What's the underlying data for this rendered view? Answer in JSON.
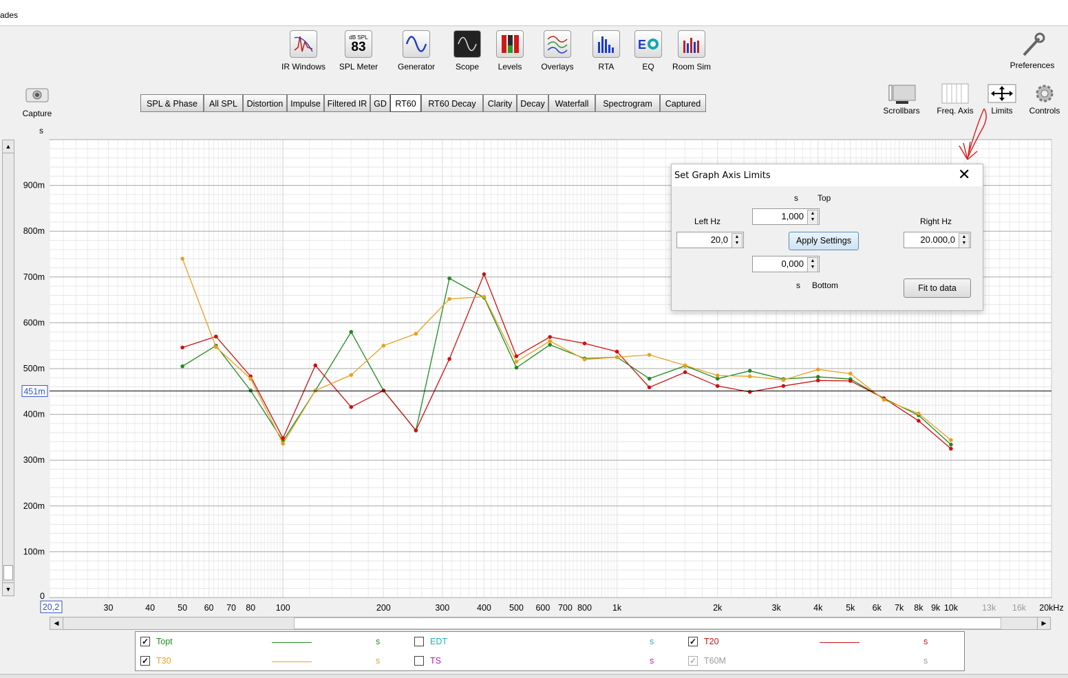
{
  "window": {
    "title_fragment": "ades"
  },
  "toolbar": [
    {
      "label": "IR Windows",
      "icon": "ir-windows-icon"
    },
    {
      "label": "SPL Meter",
      "icon": "spl-meter-icon",
      "meter_top": "dB SPL",
      "meter_value": "83"
    },
    {
      "label": "Generator",
      "icon": "generator-icon"
    },
    {
      "label": "Scope",
      "icon": "scope-icon"
    },
    {
      "label": "Levels",
      "icon": "levels-icon"
    },
    {
      "label": "Overlays",
      "icon": "overlays-icon"
    },
    {
      "label": "RTA",
      "icon": "rta-icon"
    },
    {
      "label": "EQ",
      "icon": "eq-icon"
    },
    {
      "label": "Room Sim",
      "icon": "room-sim-icon"
    }
  ],
  "preferences_label": "Preferences",
  "capture_label": "Capture",
  "tabs": [
    "SPL & Phase",
    "All SPL",
    "Distortion",
    "Impulse",
    "Filtered IR",
    "GD",
    "RT60",
    "RT60 Decay",
    "Clarity",
    "Decay",
    "Waterfall",
    "Spectrogram",
    "Captured"
  ],
  "active_tab": "RT60",
  "right_controls": [
    {
      "label": "Scrollbars",
      "icon": "scrollbars-icon"
    },
    {
      "label": "Freq. Axis",
      "icon": "freq-axis-icon"
    },
    {
      "label": "Limits",
      "icon": "limits-icon"
    },
    {
      "label": "Controls",
      "icon": "controls-gear-icon"
    }
  ],
  "graph": {
    "y_unit": "s",
    "cursor_value": "451m",
    "left_freq_box": "20,2",
    "y_ticks": [
      "900m",
      "800m",
      "700m",
      "600m",
      "500m",
      "400m",
      "300m",
      "200m",
      "100m",
      "0"
    ],
    "x_ticks": [
      "30",
      "40",
      "50",
      "60",
      "70",
      "80",
      "100",
      "200",
      "300",
      "400",
      "500",
      "600",
      "700",
      "800",
      "1k",
      "2k",
      "3k",
      "4k",
      "5k",
      "6k",
      "7k",
      "8k",
      "9k",
      "10k",
      "13k",
      "16k",
      "20kHz"
    ]
  },
  "chart_data": {
    "type": "line",
    "x_scale": "log",
    "xlim": [
      20,
      20000
    ],
    "ylim": [
      0,
      1.0
    ],
    "ylabel": "s",
    "cursor_y": 0.451,
    "grid": true,
    "series": [
      {
        "name": "Topt",
        "color": "#1e8c1e",
        "x": [
          50,
          63,
          80,
          100,
          125,
          160,
          200,
          250,
          315,
          400,
          500,
          630,
          800,
          1000,
          1250,
          1600,
          2000,
          2500,
          3150,
          4000,
          5000,
          6300,
          8000,
          10000
        ],
        "values": [
          0.505,
          0.55,
          0.452,
          0.342,
          0.452,
          0.58,
          0.452,
          0.365,
          0.697,
          0.655,
          0.502,
          0.552,
          0.522,
          0.525,
          0.478,
          0.506,
          0.478,
          0.495,
          0.477,
          0.482,
          0.477,
          0.435,
          0.398,
          0.334
        ]
      },
      {
        "name": "T20",
        "color": "#cc1111",
        "x": [
          50,
          63,
          80,
          100,
          125,
          160,
          200,
          250,
          315,
          400,
          500,
          630,
          800,
          1000,
          1250,
          1600,
          2000,
          2500,
          3150,
          4000,
          5000,
          6300,
          8000,
          10000
        ],
        "values": [
          0.546,
          0.57,
          0.483,
          0.348,
          0.507,
          0.416,
          0.452,
          0.365,
          0.521,
          0.706,
          0.527,
          0.569,
          0.555,
          0.537,
          0.459,
          0.492,
          0.462,
          0.449,
          0.462,
          0.474,
          0.473,
          0.435,
          0.386,
          0.325
        ]
      },
      {
        "name": "T30",
        "color": "#e8a020",
        "x": [
          50,
          63,
          80,
          100,
          125,
          160,
          200,
          250,
          315,
          400,
          500,
          630,
          800,
          1000,
          1250,
          1600,
          2000,
          2500,
          3150,
          4000,
          5000,
          6300,
          8000,
          10000
        ],
        "values": [
          0.74,
          0.547,
          0.478,
          0.336,
          0.452,
          0.486,
          0.55,
          0.576,
          0.652,
          0.657,
          0.515,
          0.56,
          0.52,
          0.525,
          0.53,
          0.507,
          0.485,
          0.483,
          0.475,
          0.498,
          0.489,
          0.432,
          0.402,
          0.344
        ]
      }
    ]
  },
  "legend": [
    {
      "name": "Topt",
      "unit": "s",
      "checked": true,
      "color": "#1e8c1e",
      "enabled": true
    },
    {
      "name": "EDT",
      "unit": "s",
      "checked": false,
      "color": "#20b0c0",
      "enabled": true
    },
    {
      "name": "T20",
      "unit": "s",
      "checked": true,
      "color": "#cc1111",
      "enabled": true
    },
    {
      "name": "T30",
      "unit": "s",
      "checked": true,
      "color": "#e8a020",
      "enabled": true
    },
    {
      "name": "TS",
      "unit": "s",
      "checked": false,
      "color": "#b020b0",
      "enabled": true
    },
    {
      "name": "T60M",
      "unit": "s",
      "checked": true,
      "color": "#9a9a9a",
      "enabled": false
    }
  ],
  "dialog": {
    "title": "Set Graph Axis Limits",
    "top_label": "Top",
    "bottom_label": "Bottom",
    "unit": "s",
    "top_value": "1,000",
    "bottom_value": "0,000",
    "left_label": "Left Hz",
    "left_value": "20,0",
    "right_label": "Right Hz",
    "right_value": "20.000,0",
    "apply_label": "Apply Settings",
    "fit_label": "Fit to data"
  }
}
